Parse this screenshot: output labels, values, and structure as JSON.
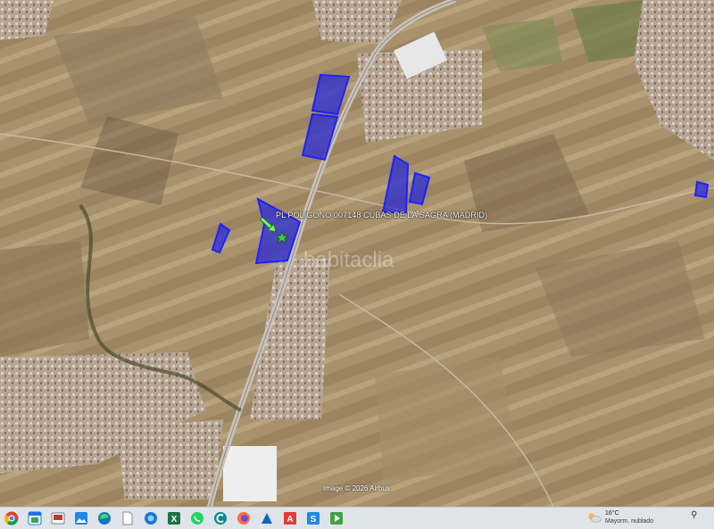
{
  "map": {
    "parcel_label": "PL POLIGONO 007148  CUBAS DE LA SAGRA (MADRID)",
    "watermark": "habitaclia",
    "credit": "Image © 2026 Airbus",
    "parcel_color": "#2a2bd6"
  },
  "taskbar": {
    "items": [
      {
        "name": "chrome-icon",
        "label": ""
      },
      {
        "name": "calendar-app-icon",
        "label": ""
      },
      {
        "name": "slides-app-icon",
        "label": ""
      },
      {
        "name": "photos-app-icon",
        "label": ""
      },
      {
        "name": "edge-icon",
        "label": ""
      },
      {
        "name": "file-icon",
        "label": ""
      },
      {
        "name": "photo-viewer-icon",
        "label": ""
      },
      {
        "name": "excel-icon",
        "label": ""
      },
      {
        "name": "whatsapp-icon",
        "label": ""
      },
      {
        "name": "app-circle-icon",
        "label": ""
      },
      {
        "name": "firefox-icon",
        "label": ""
      },
      {
        "name": "text-editor-icon",
        "label": ""
      },
      {
        "name": "acrobat-icon",
        "label": ""
      },
      {
        "name": "s-app-icon",
        "label": ""
      },
      {
        "name": "play-app-icon",
        "label": ""
      }
    ],
    "weather_temp": "16°C",
    "weather_desc": "Mayorm. nublado"
  }
}
